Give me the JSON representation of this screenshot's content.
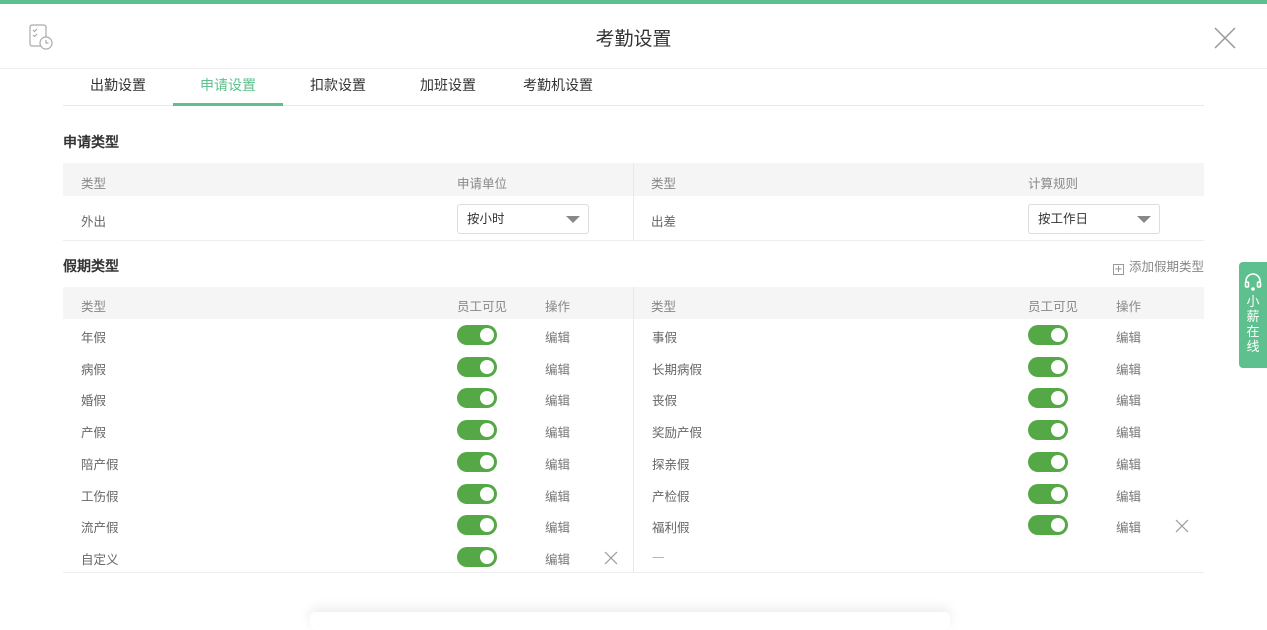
{
  "header": {
    "title": "考勤设置"
  },
  "tabs": [
    "出勤设置",
    "申请设置",
    "扣款设置",
    "加班设置",
    "考勤机设置"
  ],
  "active_tab": 1,
  "apply": {
    "section_title": "申请类型",
    "headers": [
      "类型",
      "申请单位",
      "类型",
      "计算规则"
    ],
    "left": {
      "type": "外出",
      "unit": "按小时"
    },
    "right": {
      "type": "出差",
      "rule": "按工作日"
    }
  },
  "leave": {
    "section_title": "假期类型",
    "add_label": "添加假期类型",
    "headers": [
      "类型",
      "员工可见",
      "操作",
      "类型",
      "员工可见",
      "操作"
    ],
    "edit_label": "编辑",
    "left": [
      {
        "name": "年假",
        "visible": true
      },
      {
        "name": "病假",
        "visible": true
      },
      {
        "name": "婚假",
        "visible": true
      },
      {
        "name": "产假",
        "visible": true
      },
      {
        "name": "陪产假",
        "visible": true
      },
      {
        "name": "工伤假",
        "visible": true
      },
      {
        "name": "流产假",
        "visible": true
      },
      {
        "name": "自定义",
        "visible": true,
        "deletable": true
      }
    ],
    "right": [
      {
        "name": "事假",
        "visible": true
      },
      {
        "name": "长期病假",
        "visible": true
      },
      {
        "name": "丧假",
        "visible": true
      },
      {
        "name": "奖励产假",
        "visible": true
      },
      {
        "name": "探亲假",
        "visible": true
      },
      {
        "name": "产检假",
        "visible": true
      },
      {
        "name": "福利假",
        "visible": true,
        "deletable": true
      }
    ],
    "empty_label": "—"
  },
  "widget": {
    "label": "小薪在线"
  },
  "colors": {
    "accent": "#5ec08e",
    "toggle": "#55a846"
  }
}
